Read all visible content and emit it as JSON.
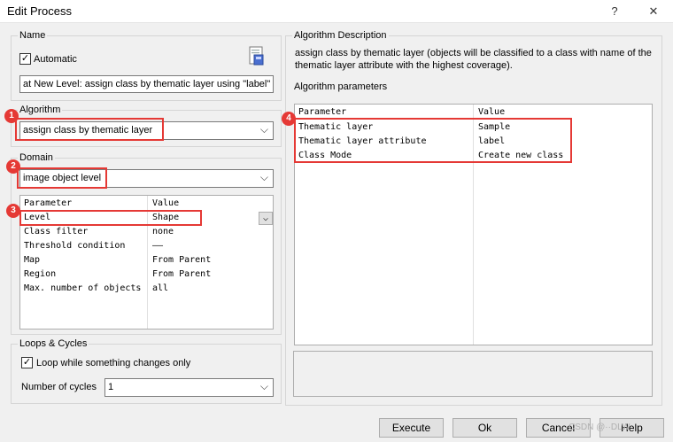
{
  "window": {
    "title": "Edit Process",
    "help": "?",
    "close": "✕"
  },
  "name_group": {
    "label": "Name",
    "automatic_label": "Automatic",
    "automatic_checked": true,
    "name_value": "at  New Level: assign class by thematic layer using \"label\""
  },
  "algorithm_group": {
    "label": "Algorithm",
    "value": "assign class by thematic layer"
  },
  "domain_group": {
    "label": "Domain",
    "value": "image object level",
    "header": [
      "Parameter",
      "Value"
    ],
    "rows": [
      [
        "Level",
        "Shape"
      ],
      [
        "Class filter",
        "none"
      ],
      [
        "Threshold condition",
        "——"
      ],
      [
        "Map",
        "From Parent"
      ],
      [
        "Region",
        "From Parent"
      ],
      [
        "Max. number of objects",
        "all"
      ]
    ]
  },
  "loops_group": {
    "label": "Loops & Cycles",
    "loop_label": "Loop while something changes only",
    "loop_checked": true,
    "cycles_label": "Number of cycles",
    "cycles_value": "1"
  },
  "description": {
    "label": "Algorithm Description",
    "line1": "assign class by thematic layer (objects will be classified to a class with name of the",
    "line2": "thematic layer attribute with the highest coverage)."
  },
  "params": {
    "label": "Algorithm parameters",
    "header": [
      "Parameter",
      "Value"
    ],
    "rows": [
      [
        "Thematic layer",
        "Sample"
      ],
      [
        "Thematic layer attribute",
        "label"
      ],
      [
        "Class Mode",
        "Create new class"
      ]
    ]
  },
  "badges": [
    "1",
    "2",
    "3",
    "4"
  ],
  "buttons": {
    "execute": "Execute",
    "ok": "Ok",
    "cancel": "Cancel",
    "help": "Help"
  },
  "watermark": "CSDN @··DLW",
  "colors": {
    "highlight": "#e53935"
  }
}
